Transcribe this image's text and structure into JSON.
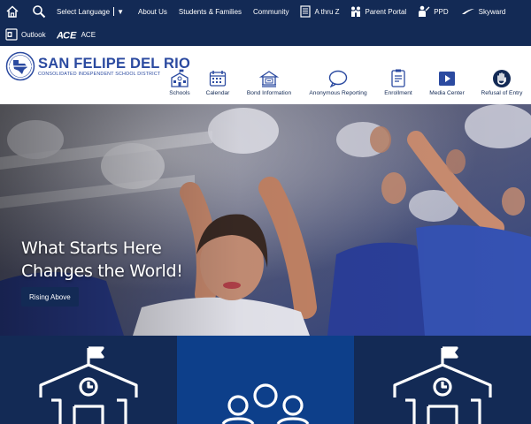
{
  "topbar": {
    "language_label": "Select Language",
    "language_caret": "▼",
    "links": [
      "About Us",
      "Students & Families",
      "Community",
      "A thru Z",
      "Parent Portal",
      "PPD",
      "Skyward"
    ],
    "row2": [
      "Outlook",
      "ACE"
    ],
    "ace_logo_text": "ACE"
  },
  "header": {
    "district_name": "SAN FELIPE DEL RIO",
    "district_sub": "CONSOLIDATED INDEPENDENT SCHOOL DISTRICT",
    "nav": [
      "Schools",
      "Calendar",
      "Bond Information",
      "Anonymous Reporting",
      "Enrollment",
      "Media Center",
      "Refusal of Entry"
    ]
  },
  "hero": {
    "title_line1": "What Starts Here",
    "title_line2": "Changes the World!",
    "button": "Rising Above"
  },
  "tiles": [
    "school-building-icon",
    "people-group-icon",
    "school-building-icon"
  ],
  "colors": {
    "navy": "#132a55",
    "brand_blue": "#2b4aa0",
    "tile_blue": "#0d3f8a"
  }
}
